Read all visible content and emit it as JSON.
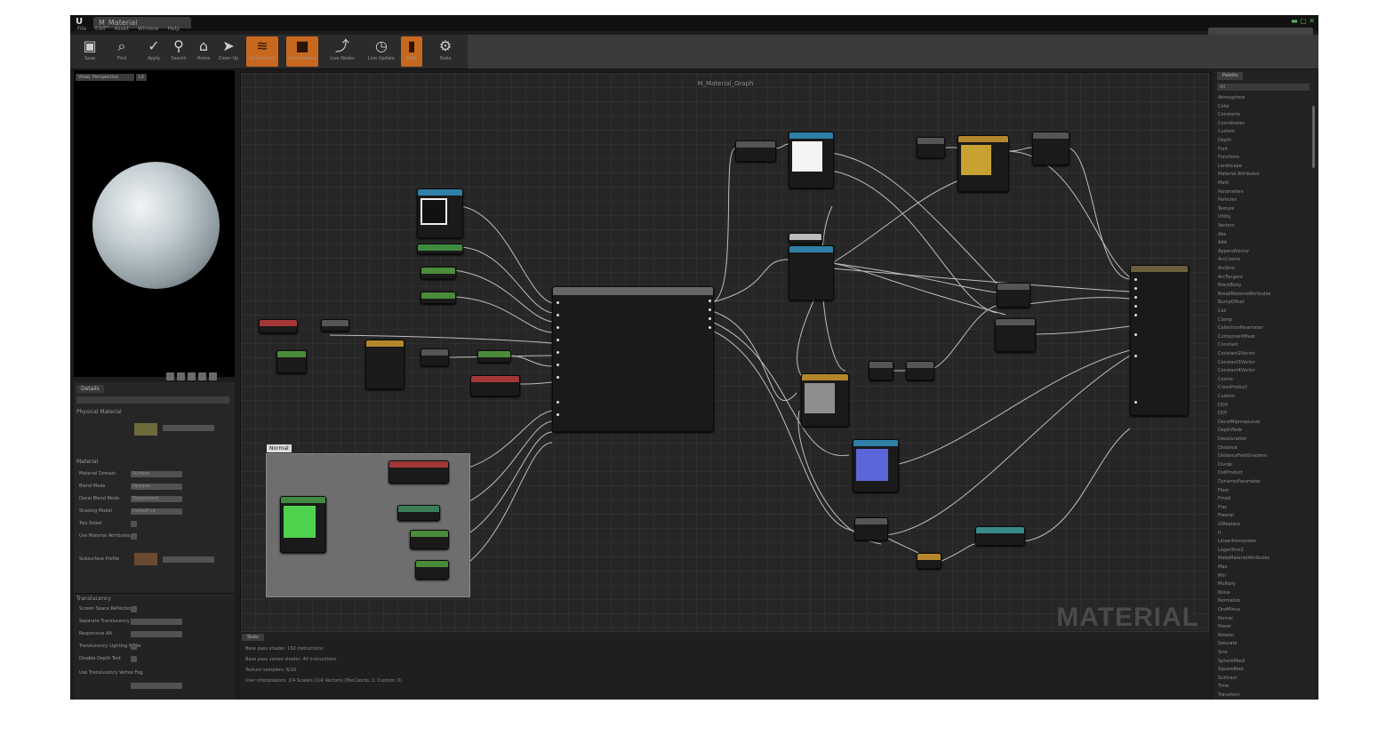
{
  "window": {
    "title_tab": "M_Material"
  },
  "menu": [
    "File",
    "Edit",
    "Asset",
    "Window",
    "Help"
  ],
  "toolbar": [
    {
      "label": "Save",
      "icon": "save-icon"
    },
    {
      "label": "Find",
      "icon": "find-icon"
    },
    {
      "label": "Apply",
      "icon": "apply-icon"
    },
    {
      "label": "Search",
      "icon": "search-icon"
    },
    {
      "label": "Home",
      "icon": "home-icon"
    },
    {
      "label": "Clean Up",
      "icon": "cleanup-icon"
    },
    {
      "label": "Connectors",
      "icon": "connectors-icon"
    },
    {
      "label": "Live Preview",
      "icon": "live-preview-icon"
    },
    {
      "label": "Live Nodes",
      "icon": "live-nodes-icon"
    },
    {
      "label": "Live Update",
      "icon": "live-update-icon"
    },
    {
      "label": "Hide",
      "icon": "hide-icon"
    },
    {
      "label": "Stats",
      "icon": "stats-icon"
    }
  ],
  "viewport": {
    "tabs": [
      "Viewport",
      "Perspective",
      "Lit"
    ]
  },
  "details": {
    "tab": "Details",
    "section_physical": "Physical Material",
    "section_material": "Material",
    "rows": [
      "Material Domain",
      "Blend Mode",
      "Decal Blend Mode",
      "Shading Model",
      "Two Sided",
      "Use Material Attributes",
      "Subsurface Profile"
    ],
    "values": [
      "Surface",
      "Opaque",
      "Translucent",
      "Default Lit"
    ]
  },
  "stats": {
    "section": "Translucency",
    "rows": [
      "Screen Space Reflections",
      "Separate Translucency",
      "Responsive AA",
      "Translucency Lighting Mode",
      "Disable Depth Test",
      "Use Translucency Vertex Fog"
    ]
  },
  "graph": {
    "title": "M_Material_Graph",
    "watermark": "MATERIAL",
    "comment": "Normal"
  },
  "log": {
    "tab": "Stats",
    "lines": [
      "Base pass shader: 192 instructions",
      "Base pass vertex shader: 40 instructions",
      "Texture samplers: 6/16",
      "User interpolators: 2/4 Scalars (1/4 Vectors) (TexCoords: 2, Custom: 0)"
    ]
  },
  "palette": {
    "tab": "Palette",
    "category": "All",
    "items": [
      "Atmosphere",
      "Color",
      "Constants",
      "Coordinates",
      "Custom",
      "Depth",
      "Font",
      "Functions",
      "Landscape",
      "Material Attributes",
      "Math",
      "Parameters",
      "Particles",
      "Texture",
      "Utility",
      "Vectors",
      "Abs",
      "Add",
      "AppendVector",
      "ArcCosine",
      "ArcSine",
      "ArcTangent",
      "BlackBody",
      "BreakMaterialAttributes",
      "BumpOffset",
      "Ceil",
      "Clamp",
      "CollectionParameter",
      "ComponentMask",
      "Constant",
      "Constant2Vector",
      "Constant3Vector",
      "Constant4Vector",
      "Cosine",
      "CrossProduct",
      "Custom",
      "DDX",
      "DDY",
      "DecalMipmapLevel",
      "DepthFade",
      "Desaturation",
      "Distance",
      "DistanceFieldGradient",
      "Divide",
      "DotProduct",
      "DynamicParameter",
      "Floor",
      "Fmod",
      "Frac",
      "Fresnel",
      "GIReplace",
      "If",
      "LinearInterpolate",
      "Logarithm2",
      "MakeMaterialAttributes",
      "Max",
      "Min",
      "Multiply",
      "Noise",
      "Normalize",
      "OneMinus",
      "Panner",
      "Power",
      "Rotator",
      "Saturate",
      "Sine",
      "SphereMask",
      "SquareRoot",
      "Subtract",
      "Time",
      "Transform"
    ]
  },
  "colors": {
    "accent": "#c8681f",
    "base_color": "#c7a233",
    "normal": "#5b67d8",
    "green": "#4ed34e",
    "white": "#f4f4f4",
    "grey": "#8e8e8e"
  }
}
